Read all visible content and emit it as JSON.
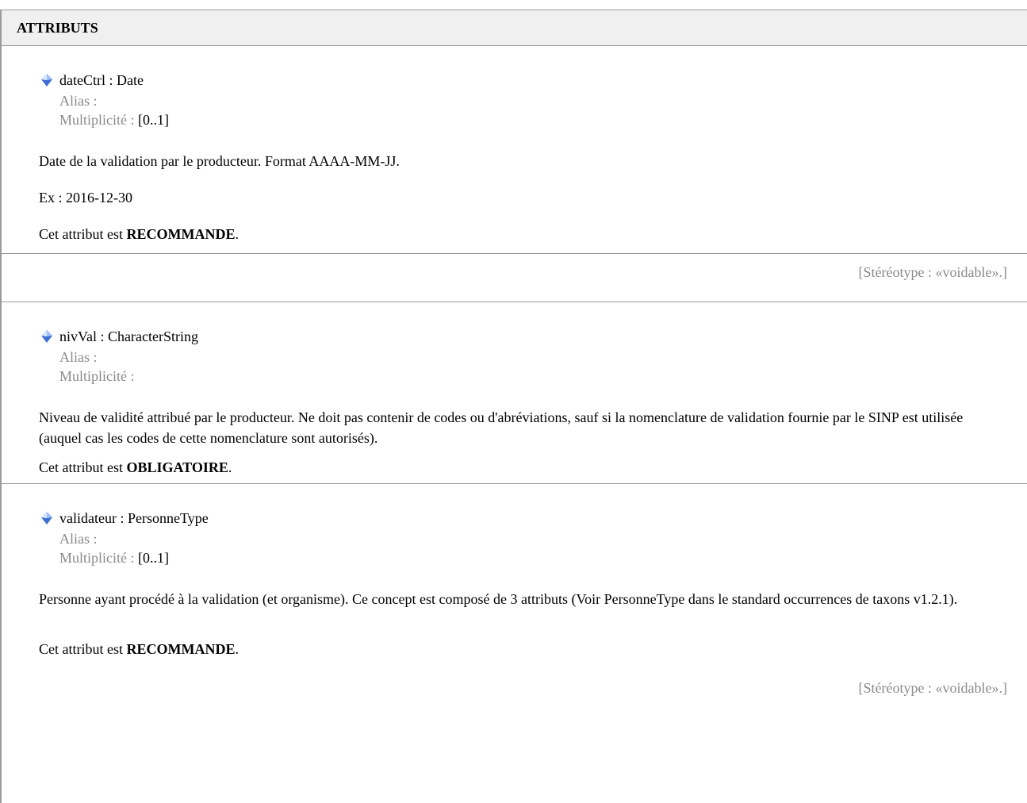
{
  "section_title": "ATTRIBUTS",
  "labels": {
    "alias": "Alias :",
    "multiplicity": "Multiplicité :"
  },
  "attributes": [
    {
      "title": "dateCtrl : Date",
      "multiplicity_value": "[0..1]",
      "description": "Date de la validation par le producteur. Format AAAA-MM-JJ.",
      "example": "Ex : 2016-12-30",
      "status_prefix": "Cet attribut est ",
      "status_value": "RECOMMANDE",
      "status_suffix": ".",
      "stereotype": "[Stéréotype : «voidable».]"
    },
    {
      "title": "nivVal : CharacterString",
      "multiplicity_value": "",
      "description": "Niveau de validité attribué par le producteur. Ne doit pas contenir de codes ou d'abréviations, sauf si la nomenclature de validation fournie par le SINP est utilisée (auquel cas les codes de cette nomenclature sont autorisés).",
      "status_prefix": "Cet attribut est ",
      "status_value": "OBLIGATOIRE",
      "status_suffix": "."
    },
    {
      "title": "validateur : PersonneType",
      "multiplicity_value": "[0..1]",
      "description": "Personne ayant procédé à la validation (et organisme). Ce concept est composé de 3 attributs (Voir PersonneType dans le standard occurrences de taxons v1.2.1).",
      "status_prefix": "Cet attribut est ",
      "status_value": "RECOMMANDE",
      "status_suffix": ".",
      "stereotype": "[Stéréotype : «voidable».]"
    }
  ],
  "colors": {
    "border": "#9a9a9a",
    "header_bg": "#f0f0f0",
    "meta_text": "#8a8a8a",
    "icon_fill": "#3f6fd1"
  },
  "icons": {
    "attribute": "attribute-diamond-icon"
  }
}
